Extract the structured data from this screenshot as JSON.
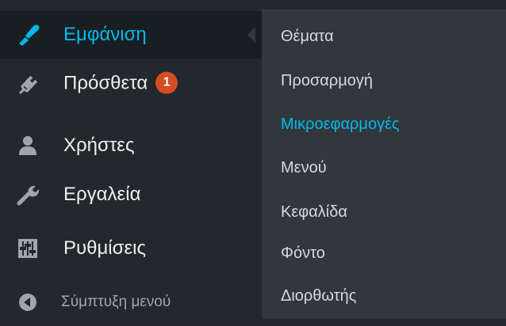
{
  "menu": {
    "items": [
      {
        "label": "Εμφάνιση",
        "icon": "paintbrush-icon",
        "current": true
      },
      {
        "label": "Πρόσθετα",
        "icon": "plugin-icon",
        "badge": "1"
      },
      {
        "label": "Χρήστες",
        "icon": "users-icon"
      },
      {
        "label": "Εργαλεία",
        "icon": "wrench-icon"
      },
      {
        "label": "Ρυθμίσεις",
        "icon": "settings-icon"
      },
      {
        "label": "Σύμπτυξη μενού",
        "icon": "collapse-icon"
      }
    ]
  },
  "submenu": {
    "items": [
      {
        "label": "Θέματα"
      },
      {
        "label": "Προσαρμογή"
      },
      {
        "label": "Μικροεφαρμογές",
        "current": true
      },
      {
        "label": "Μενού"
      },
      {
        "label": "Κεφαλίδα"
      },
      {
        "label": "Φόντο"
      },
      {
        "label": "Διορθωτής"
      }
    ]
  },
  "colors": {
    "menu_bg": "#23282d",
    "current_bg": "#191e23",
    "submenu_bg": "#32373c",
    "accent": "#00b9eb",
    "badge": "#d54e21"
  }
}
